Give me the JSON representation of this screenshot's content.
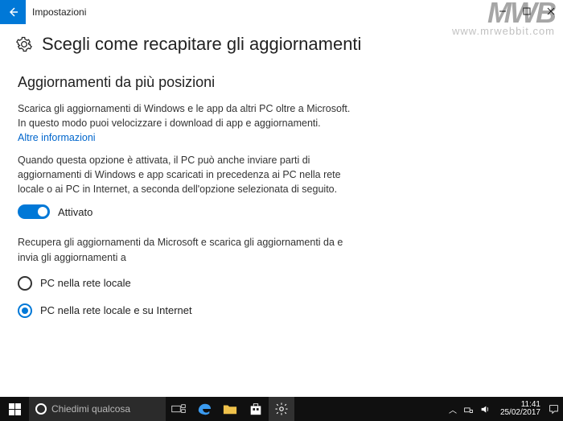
{
  "titlebar": {
    "title": "Impostazioni"
  },
  "watermark": {
    "big": "MWB",
    "small": "www.mrwebbit.com"
  },
  "header": {
    "title": "Scegli come recapitare gli aggiornamenti"
  },
  "section": {
    "heading": "Aggiornamenti da più posizioni",
    "para1": "Scarica gli aggiornamenti di Windows e le app da altri PC oltre a Microsoft. In questo modo puoi velocizzare i download di app e aggiornamenti.",
    "link": "Altre informazioni",
    "para2": "Quando questa opzione è attivata, il PC può anche inviare parti di aggiornamenti di Windows e app scaricati in precedenza ai PC nella rete locale o ai PC in Internet, a seconda dell'opzione selezionata di seguito.",
    "toggle_label": "Attivato",
    "para3": "Recupera gli aggiornamenti da Microsoft e scarica gli aggiornamenti da e invia gli aggiornamenti a",
    "radio1": "PC nella rete locale",
    "radio2": "PC nella rete locale e su Internet"
  },
  "taskbar": {
    "search_placeholder": "Chiedimi qualcosa",
    "time": "11:41",
    "date": "25/02/2017"
  }
}
